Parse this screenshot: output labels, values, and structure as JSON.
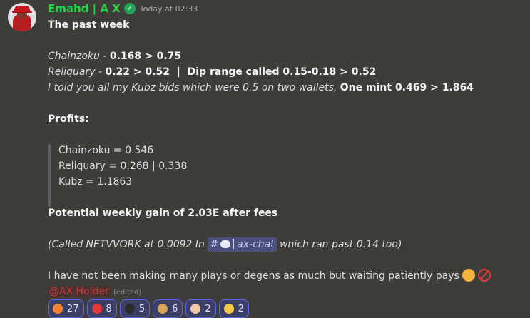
{
  "message": {
    "author": "Emahd  |  A X",
    "timestamp": "Today at 02:33",
    "lines": {
      "title": "The past week",
      "l1_label": "Chainzoku",
      "l1_sep": " - ",
      "l1_value": "0.168 > 0.75",
      "l2_label": "Reliquary",
      "l2_sep": " - ",
      "l2_value": "0.22 > 0.52  |  Dip range called 0.15-0.18 > 0.52",
      "l3_text": "I told you all my Kubz bids which were 0.5 on two wallets, ",
      "l3_bold": "One mint 0.469 > 1.864",
      "profits_heading": "Profits: ",
      "quote1": "Chainzoku = 0.546",
      "quote2": "Reliquary = 0.268 | 0.338",
      "quote3": "Kubz = 1.1863",
      "gain": "Potential weekly gain of 2.03E after fees",
      "called_pre": "(Called NETVVORK at 0.0092 In ",
      "channel_hash": "#",
      "channel_name": "ax-chat",
      "called_post": " which ran past 0.14 too)",
      "final_text": "I have not been making many plays or degens as much but waiting patiently pays",
      "mention": "@AX Holder",
      "edited": "(edited)"
    },
    "emojis": [
      "handshake-emoji",
      "no-fear-emoji"
    ]
  },
  "reactions": [
    {
      "icon": "fire-icon",
      "color": "#f4863a",
      "count": "27"
    },
    {
      "icon": "no-fear-icon",
      "color": "#e03b3b",
      "count": "8"
    },
    {
      "icon": "bomb-icon",
      "color": "#2b2b2b",
      "count": "5"
    },
    {
      "icon": "money-bag-icon",
      "color": "#d8a35a",
      "count": "6"
    },
    {
      "icon": "praying-hands-icon",
      "color": "#f1c9a8",
      "count": "2"
    },
    {
      "icon": "smiling-face-icon",
      "color": "#f7c948",
      "count": "2"
    }
  ]
}
